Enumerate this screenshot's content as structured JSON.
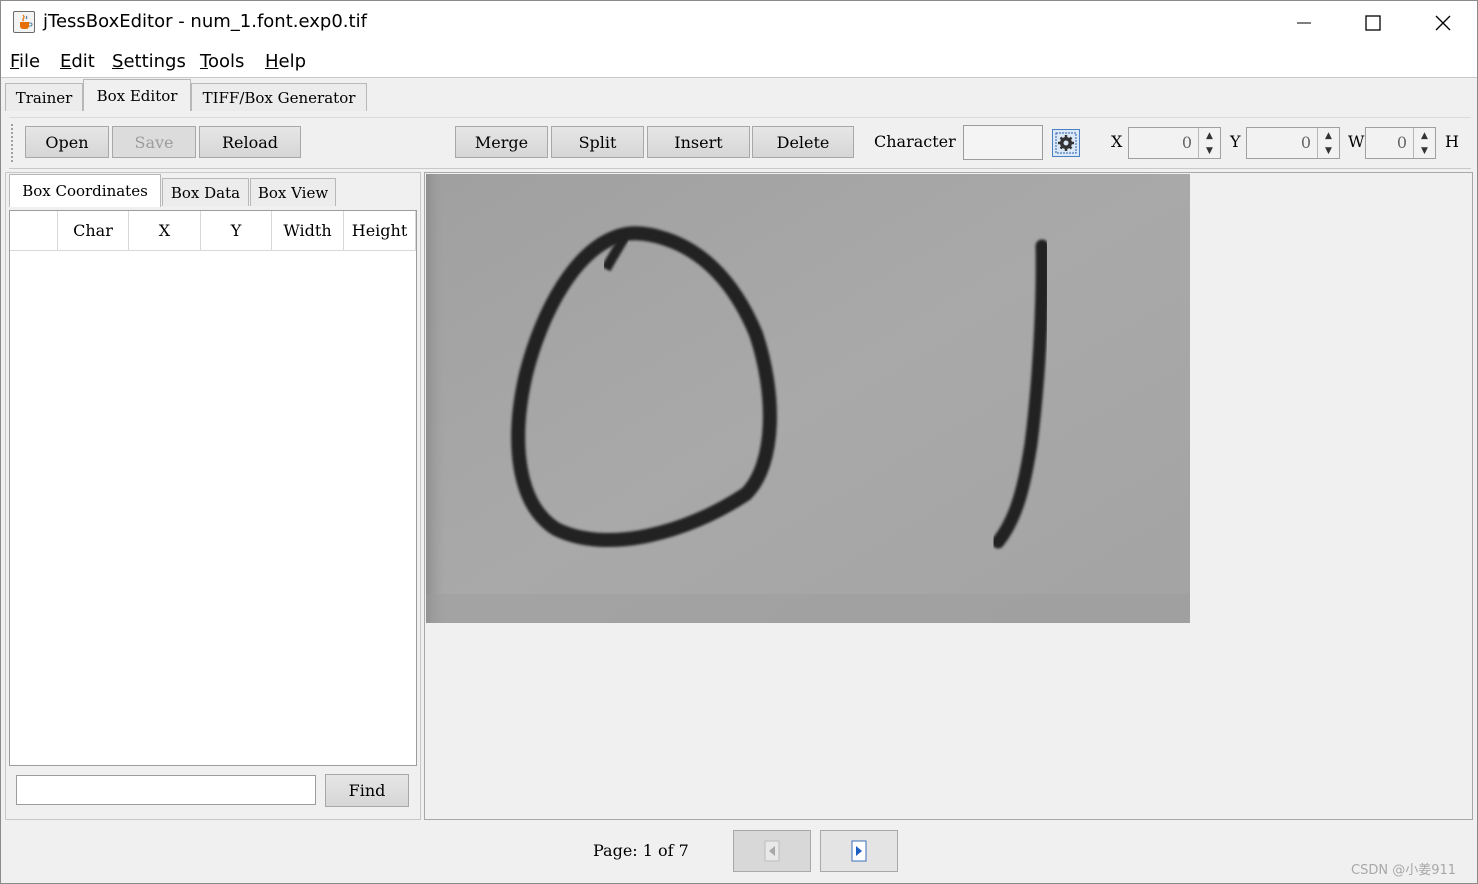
{
  "window": {
    "title": "jTessBoxEditor - num_1.font.exp0.tif",
    "icon": "java-coffee-icon"
  },
  "menu": [
    {
      "mnemonic": "F",
      "rest": "ile"
    },
    {
      "mnemonic": "E",
      "rest": "dit"
    },
    {
      "mnemonic": "S",
      "rest": "ettings"
    },
    {
      "mnemonic": "T",
      "rest": "ools"
    },
    {
      "mnemonic": "H",
      "rest": "elp"
    }
  ],
  "tabs": [
    "Trainer",
    "Box Editor",
    "TIFF/Box Generator"
  ],
  "active_tab": "Box Editor",
  "toolbar": {
    "open": "Open",
    "save": "Save",
    "reload": "Reload",
    "merge": "Merge",
    "split": "Split",
    "insert": "Insert",
    "delete": "Delete",
    "character_label": "Character",
    "character_value": "",
    "x_label": "X",
    "x_value": "0",
    "y_label": "Y",
    "y_value": "0",
    "w_label": "W",
    "w_value": "0",
    "h_label": "H"
  },
  "left_tabs": [
    "Box Coordinates",
    "Box Data",
    "Box View"
  ],
  "active_left_tab": "Box Coordinates",
  "table": {
    "columns": [
      "",
      "Char",
      "X",
      "Y",
      "Width",
      "Height"
    ],
    "rows": []
  },
  "find": {
    "value": "",
    "button": "Find"
  },
  "image": {
    "description_icon": "handwritten-digits-image",
    "background": "#a6a6a6"
  },
  "pagination": {
    "label": "Page:  1 of 7"
  },
  "watermark": "CSDN @小姜911"
}
